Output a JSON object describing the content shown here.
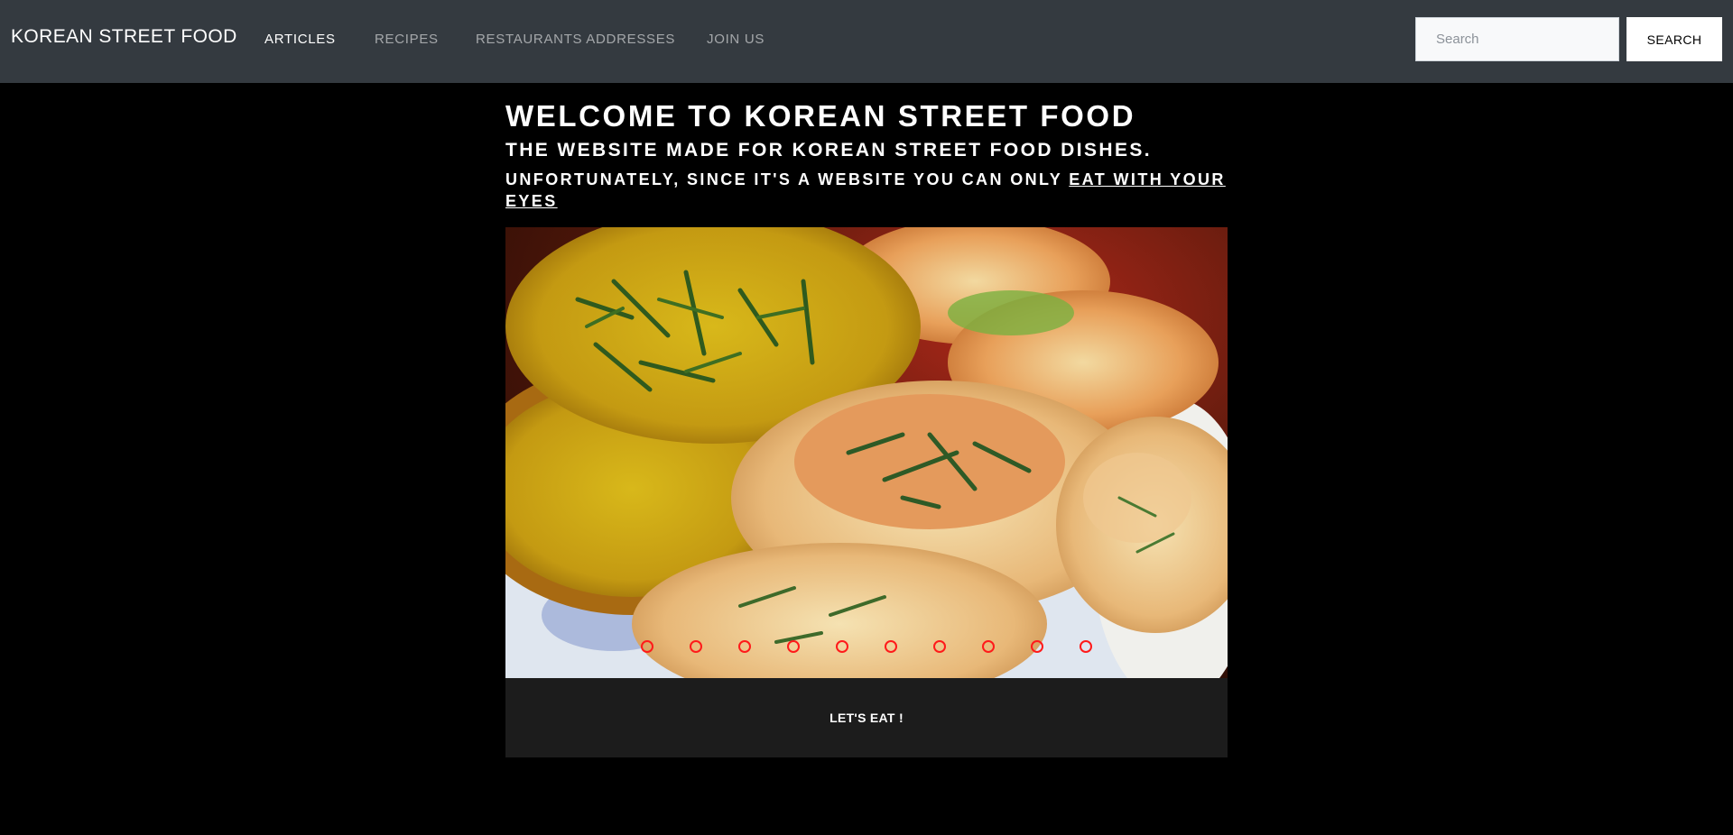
{
  "navbar": {
    "brand": "KOREAN STREET FOOD",
    "links": [
      "ARTICLES",
      "RECIPES",
      "RESTAURANTS ADDRESSES",
      "JOIN US"
    ],
    "active_link": "ARTICLES",
    "search_placeholder": "Search",
    "search_button": "SEARCH",
    "background_color": "#343a40"
  },
  "hero": {
    "title": "WELCOME TO KOREAN STREET FOOD",
    "subtitle": "THE WEBSITE MADE FOR KOREAN STREET FOOD DISHES.",
    "tagline_prefix": "UNFORTUNATELY, SINCE IT'S A WEBSITE YOU CAN ONLY ",
    "tagline_link": "EAT WITH YOUR EYES"
  },
  "carousel": {
    "slide_count": 10,
    "indicator_color": "#ff1a1a"
  },
  "cta": {
    "label": "LET'S EAT !"
  }
}
